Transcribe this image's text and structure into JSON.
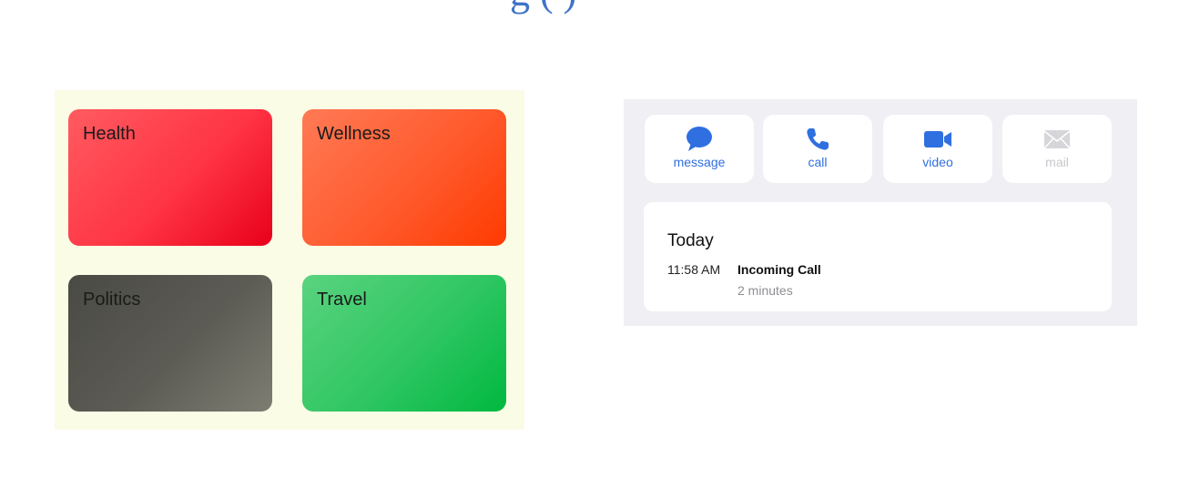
{
  "header": {
    "title": "g  (  )"
  },
  "categories": [
    {
      "label": "Health",
      "color": "#ff3444"
    },
    {
      "label": "Wellness",
      "color": "#ff5a2d"
    },
    {
      "label": "Politics",
      "color": "#5c5c55"
    },
    {
      "label": "Travel",
      "color": "#2fc663"
    }
  ],
  "contact_actions": [
    {
      "label": "message",
      "icon": "speech-bubble-icon",
      "enabled": true
    },
    {
      "label": "call",
      "icon": "phone-icon",
      "enabled": true
    },
    {
      "label": "video",
      "icon": "video-camera-icon",
      "enabled": true
    },
    {
      "label": "mail",
      "icon": "envelope-icon",
      "enabled": false
    }
  ],
  "call_history": {
    "heading": "Today",
    "entries": [
      {
        "time": "11:58 AM",
        "type": "Incoming Call",
        "duration": "2 minutes"
      }
    ]
  },
  "colors": {
    "accent": "#2f6fe0",
    "panel_background": "#efeff4",
    "tiles_background": "#fbfce6",
    "disabled": "#c8c8cc"
  }
}
